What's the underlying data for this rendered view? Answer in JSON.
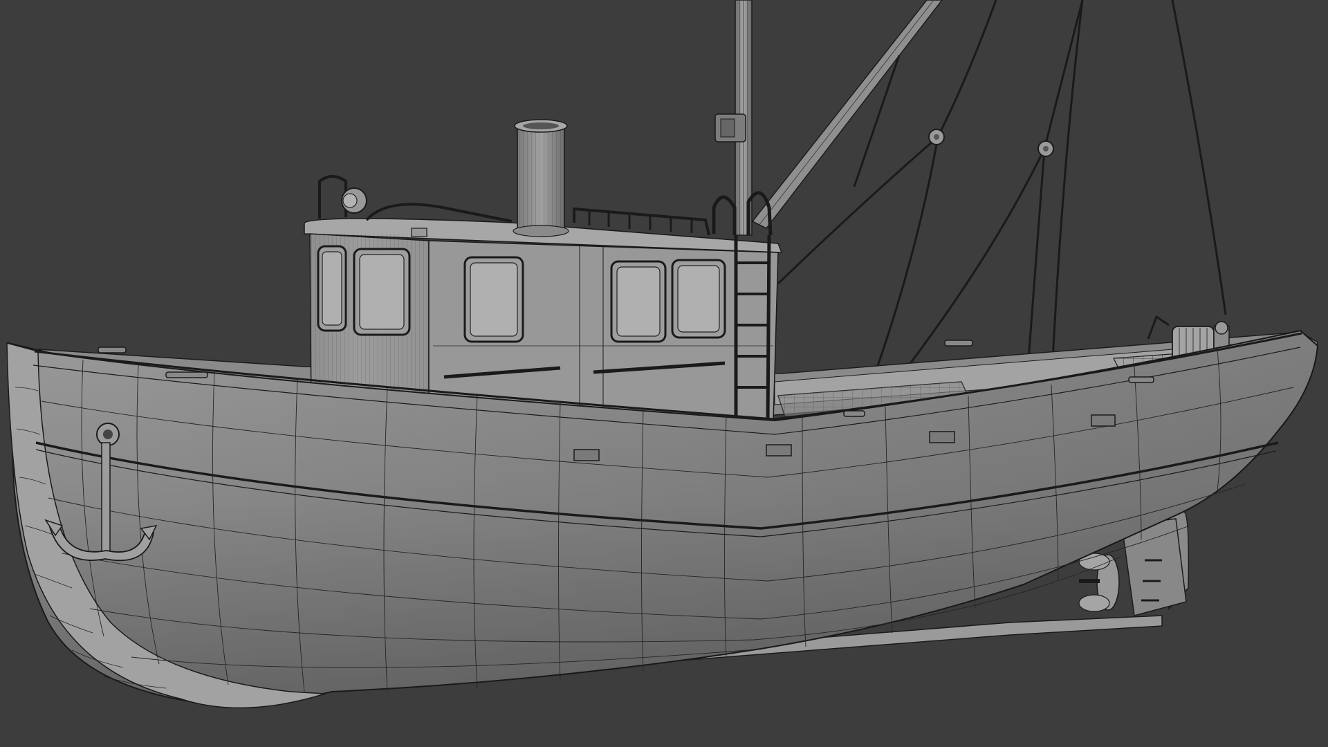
{
  "viewport": {
    "background_color": "#3d3d3d",
    "render_mode": "solid-shaded-with-wireframe"
  },
  "model": {
    "subject": "fishing-trawler",
    "hull_color": "#8d8d8d",
    "hull_shadow_color": "#5e5e5e",
    "wire_color": "#1c1c1c",
    "parts": [
      "hull",
      "keel",
      "wheelhouse",
      "funnel",
      "mast",
      "boom",
      "rigging",
      "anchor",
      "ladder",
      "winch",
      "rudder",
      "propeller"
    ]
  }
}
